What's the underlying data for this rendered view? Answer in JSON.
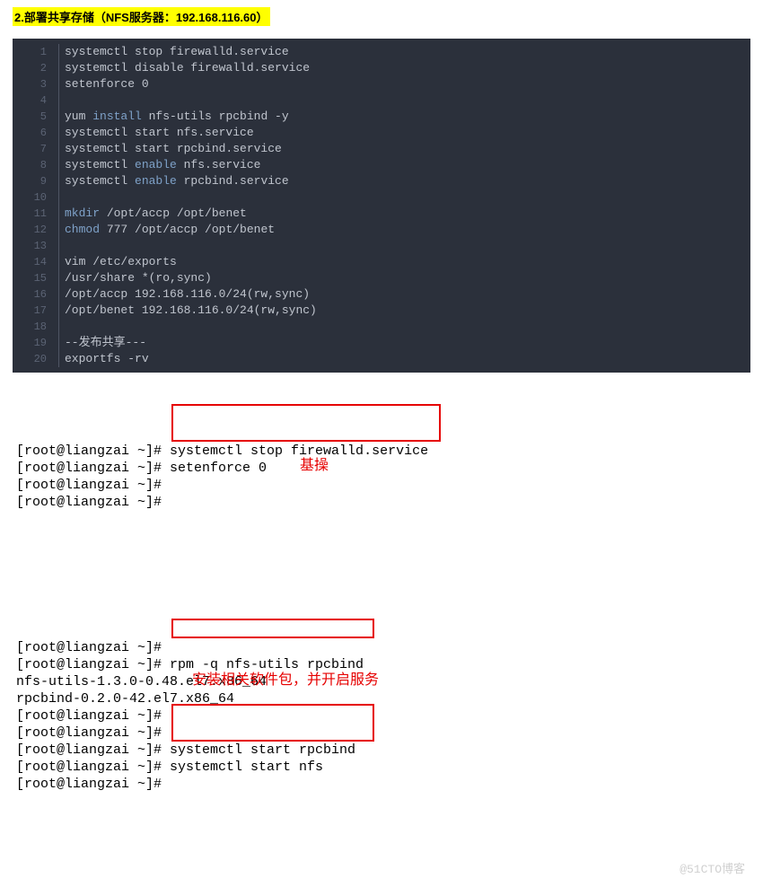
{
  "heading": "2.部署共享存储（NFS服务器：192.168.116.60）",
  "code": {
    "lineCount": 20,
    "lines": [
      {
        "t": "systemctl stop firewalld.service"
      },
      {
        "t": "systemctl disable firewalld.service"
      },
      {
        "t": "setenforce 0"
      },
      {
        "t": ""
      },
      {
        "pre": "yum ",
        "kw": "install",
        "post": " nfs-utils rpcbind -y"
      },
      {
        "t": "systemctl start nfs.service"
      },
      {
        "t": "systemctl start rpcbind.service"
      },
      {
        "pre": "systemctl ",
        "kw": "enable",
        "post": " nfs.service"
      },
      {
        "pre": "systemctl ",
        "kw": "enable",
        "post": " rpcbind.service"
      },
      {
        "t": ""
      },
      {
        "kw": "mkdir",
        "post": " /opt/accp /opt/benet"
      },
      {
        "kw": "chmod",
        "post": " 777 /opt/accp /opt/benet"
      },
      {
        "t": ""
      },
      {
        "t": "vim /etc/exports"
      },
      {
        "t": "/usr/share *(ro,sync)"
      },
      {
        "t": "/opt/accp 192.168.116.0/24(rw,sync)"
      },
      {
        "t": "/opt/benet 192.168.116.0/24(rw,sync)"
      },
      {
        "t": ""
      },
      {
        "t": "--发布共享---"
      },
      {
        "t": "exportfs -rv"
      }
    ]
  },
  "term1": {
    "lines": [
      "[root@liangzai ~]# systemctl stop firewalld.service",
      "[root@liangzai ~]# setenforce 0",
      "[root@liangzai ~]#",
      "[root@liangzai ~]#"
    ],
    "anno": "基操"
  },
  "term2": {
    "lines": [
      "[root@liangzai ~]#",
      "[root@liangzai ~]# rpm -q nfs-utils rpcbind",
      "nfs-utils-1.3.0-0.48.el7.x86_64",
      "rpcbind-0.2.0-42.el7.x86_64",
      "[root@liangzai ~]#",
      "[root@liangzai ~]#",
      "[root@liangzai ~]# systemctl start rpcbind",
      "[root@liangzai ~]# systemctl start nfs",
      "[root@liangzai ~]#"
    ],
    "anno": "安装相关软件包，并开启服务",
    "watermark": "@51CTO博客"
  }
}
